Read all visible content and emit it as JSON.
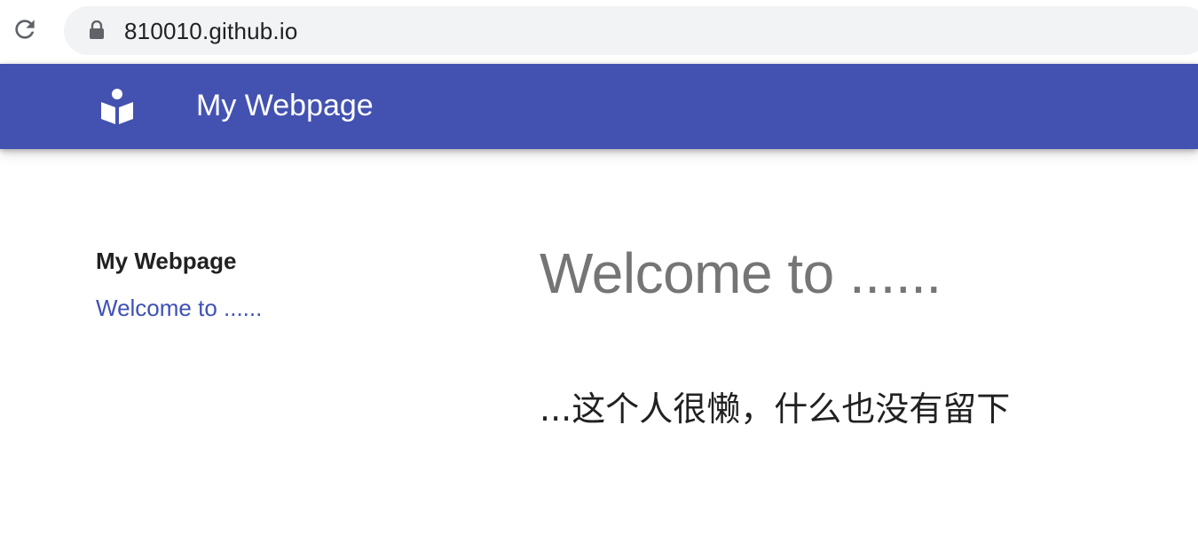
{
  "browser": {
    "url": "810010.github.io",
    "reload_icon": "reload-icon",
    "lock_icon": "lock-icon"
  },
  "header": {
    "logo_icon": "book-reader-icon",
    "title": "My Webpage",
    "background_color": "#4352b0"
  },
  "sidebar": {
    "title": "My Webpage",
    "links": [
      {
        "label": "Welcome to ......"
      }
    ],
    "link_color": "#3f51b5"
  },
  "main": {
    "heading": "Welcome to ......",
    "text": "...这个人很懒，什么也没有留下"
  }
}
